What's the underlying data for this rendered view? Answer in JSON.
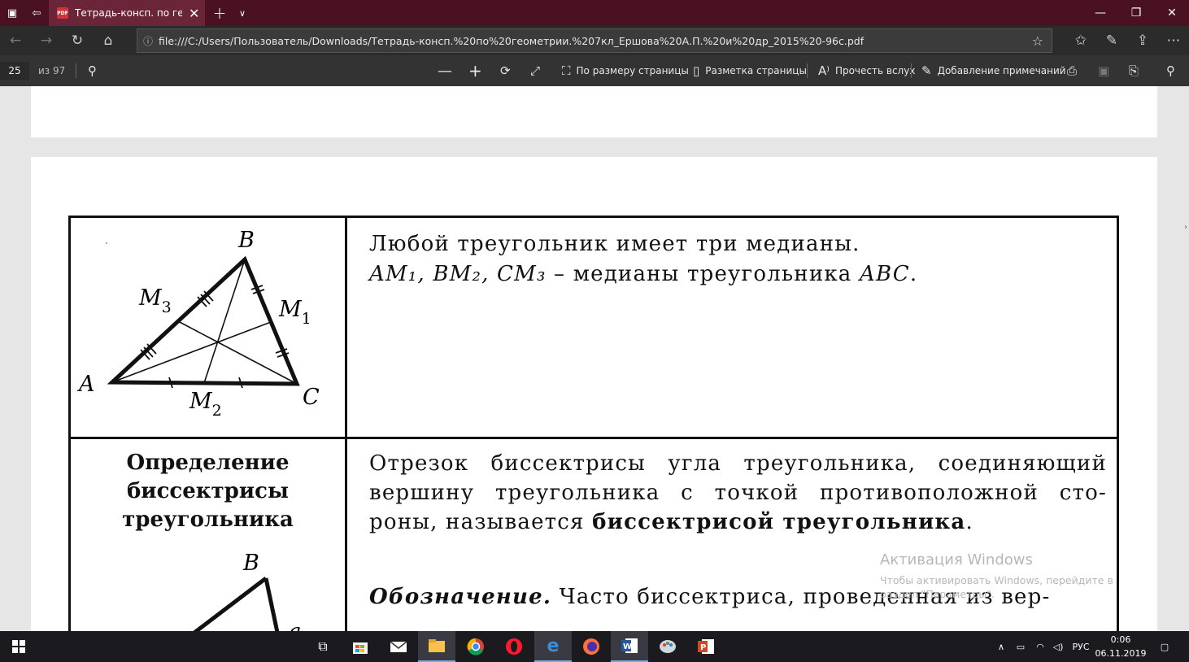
{
  "browser": {
    "tab_title": "Тетрадь-консп. по геом",
    "pdf_badge": "PDF",
    "url": "file:///C:/Users/Пользователь/Downloads/Тетрадь-консп.%20по%20геометрии.%207кл_Ершова%20А.П.%20и%20др_2015%20-96с.pdf"
  },
  "pdf_toolbar": {
    "page_number": "25",
    "page_total": "из 97",
    "fit_page": "По размеру страницы",
    "page_layout": "Разметка страницы",
    "read_aloud": "Прочесть вслух",
    "add_notes": "Добавление примечаний"
  },
  "document": {
    "row1_text": "Любой треугольник имеет три медианы.",
    "medians_names": "AM₁, BM₂, CM₃",
    "medians_dash": " – медианы треугольника ",
    "medians_abc": "ABC",
    "medians_end": ".",
    "figure1_labels": {
      "A": "A",
      "B": "B",
      "C": "C",
      "M1": "M",
      "M1_sub": "1",
      "M2": "M",
      "M2_sub": "2",
      "M3": "M",
      "M3_sub": "3"
    },
    "def_title_line1": "Определение",
    "def_title_line2": "биссектрисы",
    "def_title_line3": "треугольника",
    "def_text_start": "Отрезок биссектрисы угла треугольника, соединяющий вершину треугольника с точкой противоположной сто-роны, называется ",
    "def_text_bold": "биссектрисой треугольника",
    "def_text_end": ".",
    "notation_label": "Обозначение.",
    "notation_text": " Часто биссектриса, проведенная из вер-",
    "figure2_labels": {
      "B": "B",
      "a": "a"
    }
  },
  "watermark": {
    "title": "Активация Windows",
    "text": "Чтобы активировать Windows, перейдите в раздел \"Параметры\"."
  },
  "taskbar": {
    "language": "РУС",
    "time": "0:06",
    "date": "06.11.2019"
  }
}
